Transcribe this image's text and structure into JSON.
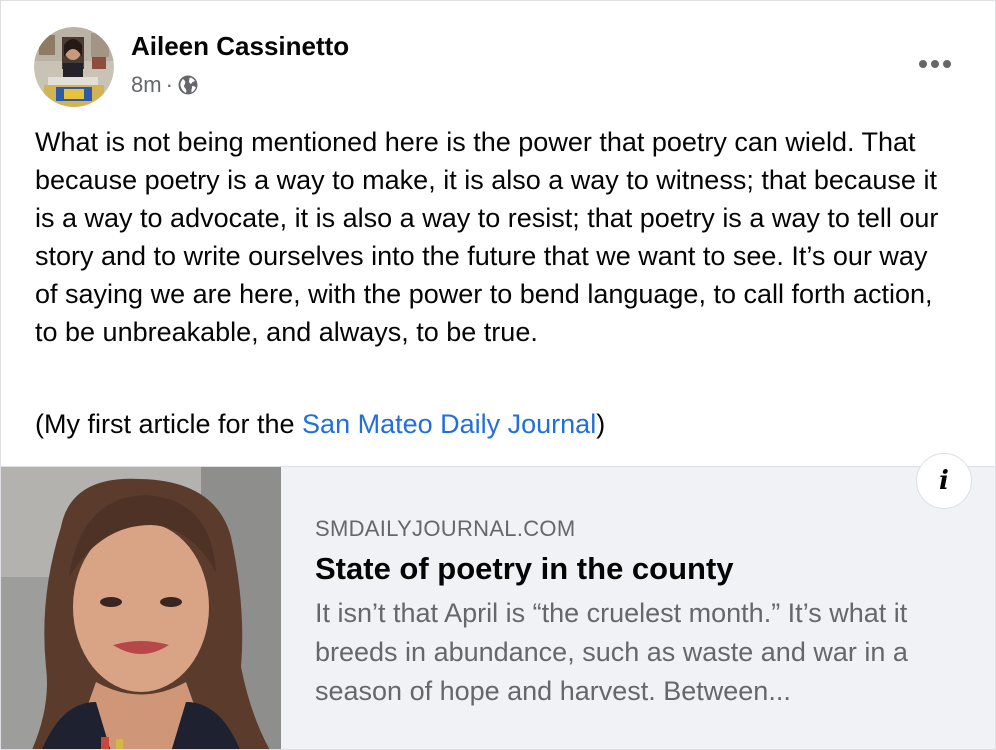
{
  "post": {
    "author": "Aileen Cassinetto",
    "timestamp": "8m",
    "separator": "·",
    "privacy_icon": "globe-icon",
    "more_icon": "more-horizontal-icon",
    "text_paragraph": "What is not being mentioned here is the power that poetry can wield. That because poetry is a way to make, it is also a way to witness; that because it is a way to advocate, it is also a way to resist; that poetry is a way to tell our story and to write ourselves into the future that we want to see. It’s our way of saying we are here, with the power to bend language, to call forth action, to be unbreakable, and always, to be true.",
    "attribution_prefix": "(My first article for the ",
    "attribution_link": "San Mateo Daily Journal",
    "attribution_suffix": ")"
  },
  "link_preview": {
    "domain": "SMDAILYJOURNAL.COM",
    "title": "State of poetry in the county",
    "description": "It isn’t that April is “the cruelest month.” It’s what it breeds in abundance, such as waste and war in a season of hope and harvest. Between...",
    "info_icon": "info-icon",
    "info_label": "i"
  },
  "colors": {
    "link": "#216fdb",
    "text": "#050505",
    "secondary": "#65676b",
    "preview_bg": "#f0f2f5"
  }
}
